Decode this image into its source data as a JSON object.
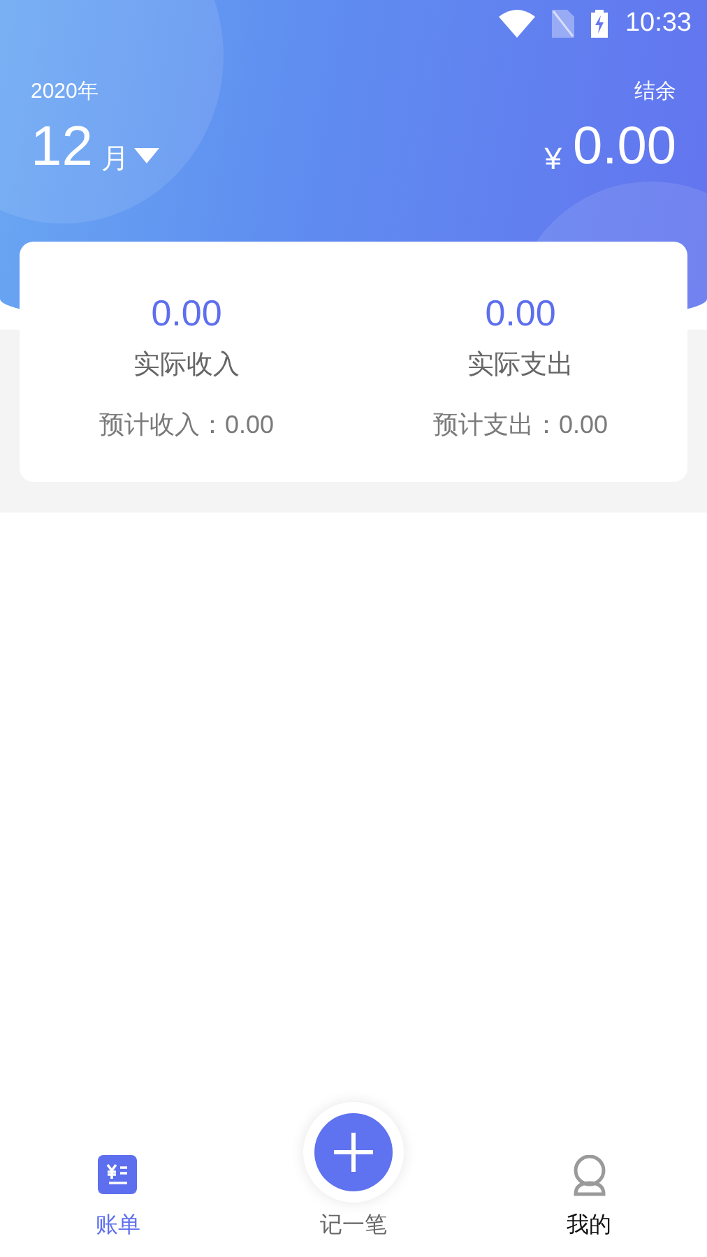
{
  "status_bar": {
    "time": "10:33"
  },
  "header": {
    "year": "2020年",
    "month": "12",
    "month_unit": "月",
    "balance_label": "结余",
    "currency": "¥",
    "balance": "0.00"
  },
  "summary": [
    {
      "amount": "0.00",
      "label": "实际收入",
      "estimate": "预计收入：0.00"
    },
    {
      "amount": "0.00",
      "label": "实际支出",
      "estimate": "预计支出：0.00"
    }
  ],
  "nav": [
    {
      "kind": "bill",
      "label": "账单",
      "selected": true
    },
    {
      "kind": "add",
      "label": "记一笔",
      "selected": false
    },
    {
      "kind": "me",
      "label": "我的",
      "selected": false
    }
  ]
}
